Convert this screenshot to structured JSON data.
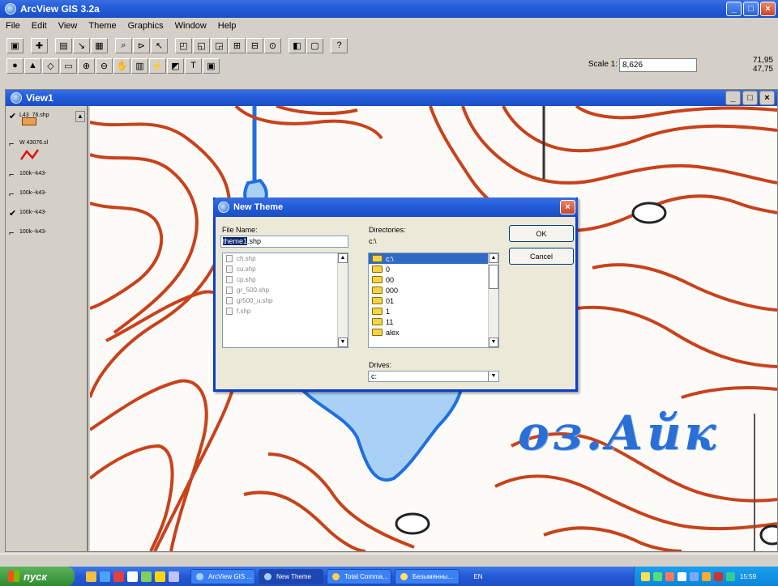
{
  "app": {
    "title": "ArcView GIS 3.2a",
    "win_buttons": [
      "_",
      "□",
      "×"
    ]
  },
  "menu": [
    "File",
    "Edit",
    "View",
    "Theme",
    "Graphics",
    "Window",
    "Help"
  ],
  "toolbar": {
    "scale_label": "Scale 1:",
    "scale_value": "8,626",
    "coords_x": "71,95",
    "coords_y": "47,75"
  },
  "view": {
    "title": "View1",
    "toc": [
      {
        "checked": true,
        "label": "L43_76.shp"
      },
      {
        "checked": false,
        "label": "W 43076.sl"
      },
      {
        "checked": false,
        "label": "100k--k43-"
      },
      {
        "checked": false,
        "label": "100k--k43-"
      },
      {
        "checked": true,
        "label": "100k--k43-"
      },
      {
        "checked": false,
        "label": "100k--k43-"
      }
    ],
    "map_label": "оз.Айк",
    "marker_1": "О"
  },
  "dialog": {
    "title": "New Theme",
    "file_name_label": "File Name:",
    "file_name_selected": "theme1",
    "file_name_ext": ".shp",
    "files": [
      "ch.shp",
      "cu.shp",
      "cp.shp",
      "gr_500.shp",
      "gr500_u.shp",
      "f.shp"
    ],
    "directories_label": "Directories:",
    "current_dir": "c:\\",
    "dirs": [
      "c:\\",
      "0",
      "00",
      "000",
      "01",
      "1",
      "11",
      "alex"
    ],
    "drives_label": "Drives:",
    "drive": "c:",
    "ok_label": "OK",
    "cancel_label": "Cancel"
  },
  "taskbar": {
    "start_label": "пуск",
    "tasks": [
      "ArcView GIS ...",
      "New Theme",
      "Total Comma...",
      "Безымянны..."
    ],
    "lang": "EN",
    "clock": "15:59"
  }
}
